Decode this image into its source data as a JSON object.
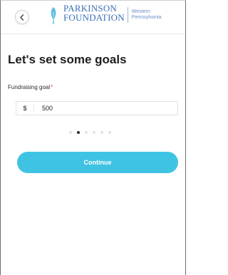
{
  "header": {
    "back_icon": "chevron-left-icon",
    "logo": {
      "line1": "PARKINSON",
      "line2": "FOUNDATION",
      "sub_line1": "Western",
      "sub_line2": "Pennsylvania",
      "brand_color": "#3d6fb6"
    }
  },
  "main": {
    "title": "Let's set some goals",
    "field": {
      "label": "Fundraising goal",
      "required_mark": "*",
      "currency": "$",
      "value": "500"
    },
    "pager": {
      "total_steps": 6,
      "current_step": 2
    },
    "continue_label": "Continue"
  },
  "colors": {
    "accent": "#3fc3e3",
    "required": "#e2334a",
    "active_dot": "#2b2b2b",
    "inactive_dot": "#e3e3e3"
  }
}
